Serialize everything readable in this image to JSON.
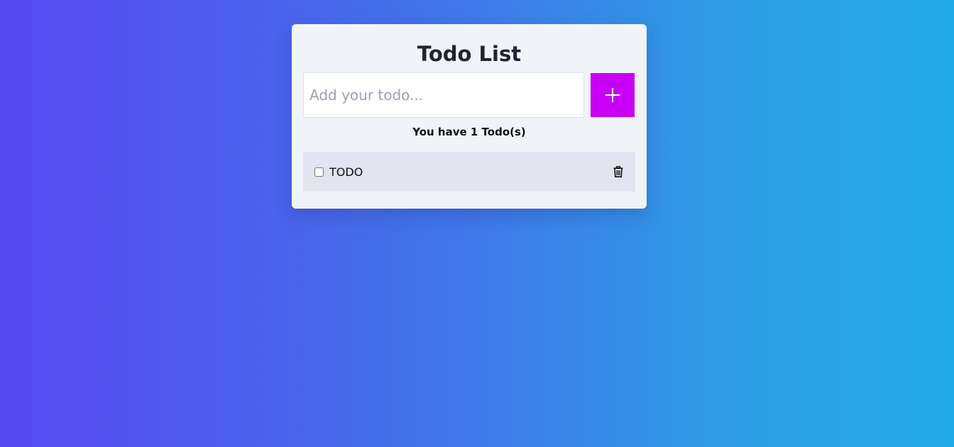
{
  "app": {
    "title": "Todo List"
  },
  "input": {
    "value": "",
    "placeholder": "Add your todo..."
  },
  "add_button": {
    "icon": "plus-icon",
    "color": "#c800f5"
  },
  "counter": {
    "text": "You have 1 Todo(s)"
  },
  "todos": [
    {
      "text": "TODO",
      "checked": false,
      "delete_icon": "trash-icon"
    }
  ],
  "colors": {
    "background_start": "#5849f0",
    "background_end": "#22aae4",
    "card": "#f0f3f8",
    "item": "#e2e5ef",
    "accent": "#c800f5"
  }
}
